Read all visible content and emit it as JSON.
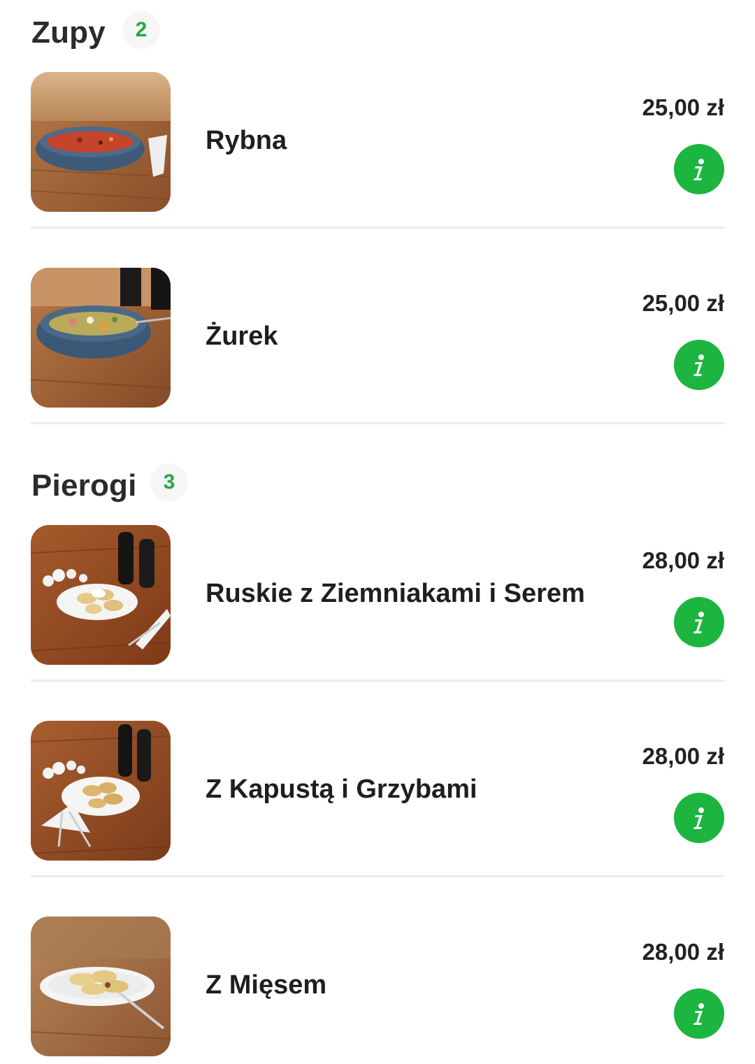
{
  "sections": [
    {
      "title": "Zupy",
      "count": "2",
      "items": [
        {
          "name": "Rybna",
          "price": "25,00 zł",
          "info_icon": "info-icon"
        },
        {
          "name": "Żurek",
          "price": "25,00 zł",
          "info_icon": "info-icon"
        }
      ]
    },
    {
      "title": "Pierogi",
      "count": "3",
      "items": [
        {
          "name": "Ruskie z Ziemniakami i Serem",
          "price": "28,00 zł",
          "info_icon": "info-icon"
        },
        {
          "name": "Z Kapustą i Grzybami",
          "price": "28,00 zł",
          "info_icon": "info-icon"
        },
        {
          "name": "Z Mięsem",
          "price": "28,00 zł",
          "info_icon": "info-icon"
        }
      ]
    }
  ],
  "colors": {
    "accent_green": "#1cb53f",
    "count_green": "#27a745",
    "divider": "#ececec"
  }
}
